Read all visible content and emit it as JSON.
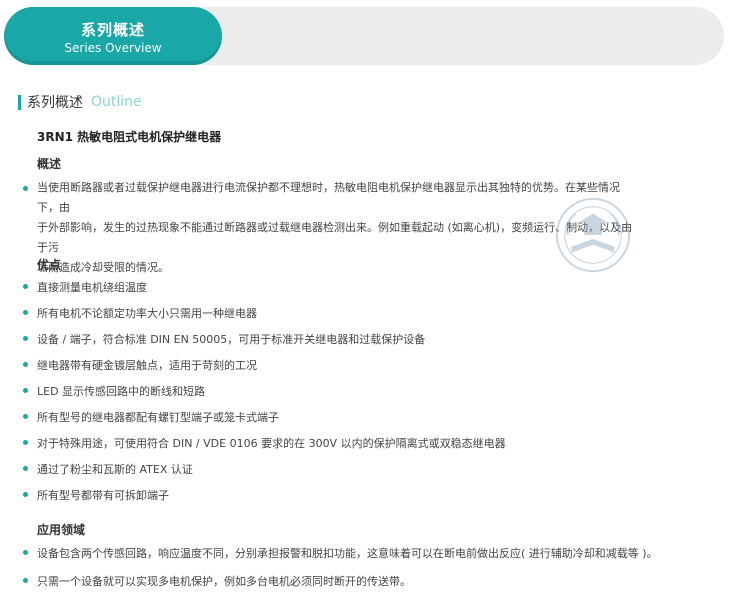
{
  "banner": {
    "title_cn": "系列概述",
    "title_en": "Series Overview"
  },
  "section": {
    "heading_cn": "系列概述",
    "heading_en": "Outline"
  },
  "product": {
    "name": "3RN1 热敏电阻式电机保护继电器"
  },
  "overview": {
    "heading": "概述",
    "lines": [
      "当使用断路器或者过载保护继电器进行电流保护都不理想时，热敏电阻电机保护继电器显示出其独特的优势。在某些情况下，由",
      "于外部影响，发生的过热现象不能通过断路器或过载继电器检测出来。例如重载起动 (如离心机)，变频运行、制动，以及由于污",
      "垢而造成冷却受限的情况。"
    ]
  },
  "advantages": {
    "heading": "优点",
    "items": [
      "直接测量电机绕组温度",
      "所有电机不论额定功率大小只需用一种继电器",
      "设备 / 端子，符合标准 DIN EN 50005，可用于标准开关继电器和过载保护设备",
      "继电器带有硬金镀层触点，适用于苛刻的工况",
      "LED 显示传感回路中的断线和短路",
      "所有型号的继电器都配有螺钉型端子或笼卡式端子",
      "对于特殊用途，可使用符合 DIN / VDE 0106 要求的在 300V 以内的保护隔离式或双稳态继电器",
      "通过了粉尘和瓦斯的 ATEX 认证",
      "所有型号都带有可拆卸端子"
    ]
  },
  "applications": {
    "heading": "应用领域",
    "items": [
      "设备包含两个传感回路，响应温度不同，分别承担报警和脱扣功能，这意味着可以在断电前做出反应( 进行辅助冷却和减载等 )。",
      "只需一个设备就可以实现多电机保护，例如多台电机必须同时断开的传送带。"
    ]
  },
  "colors": {
    "accent": "#1aa7a8",
    "banner_bg": "#ececec",
    "outline_text": "#8fd3d4"
  }
}
